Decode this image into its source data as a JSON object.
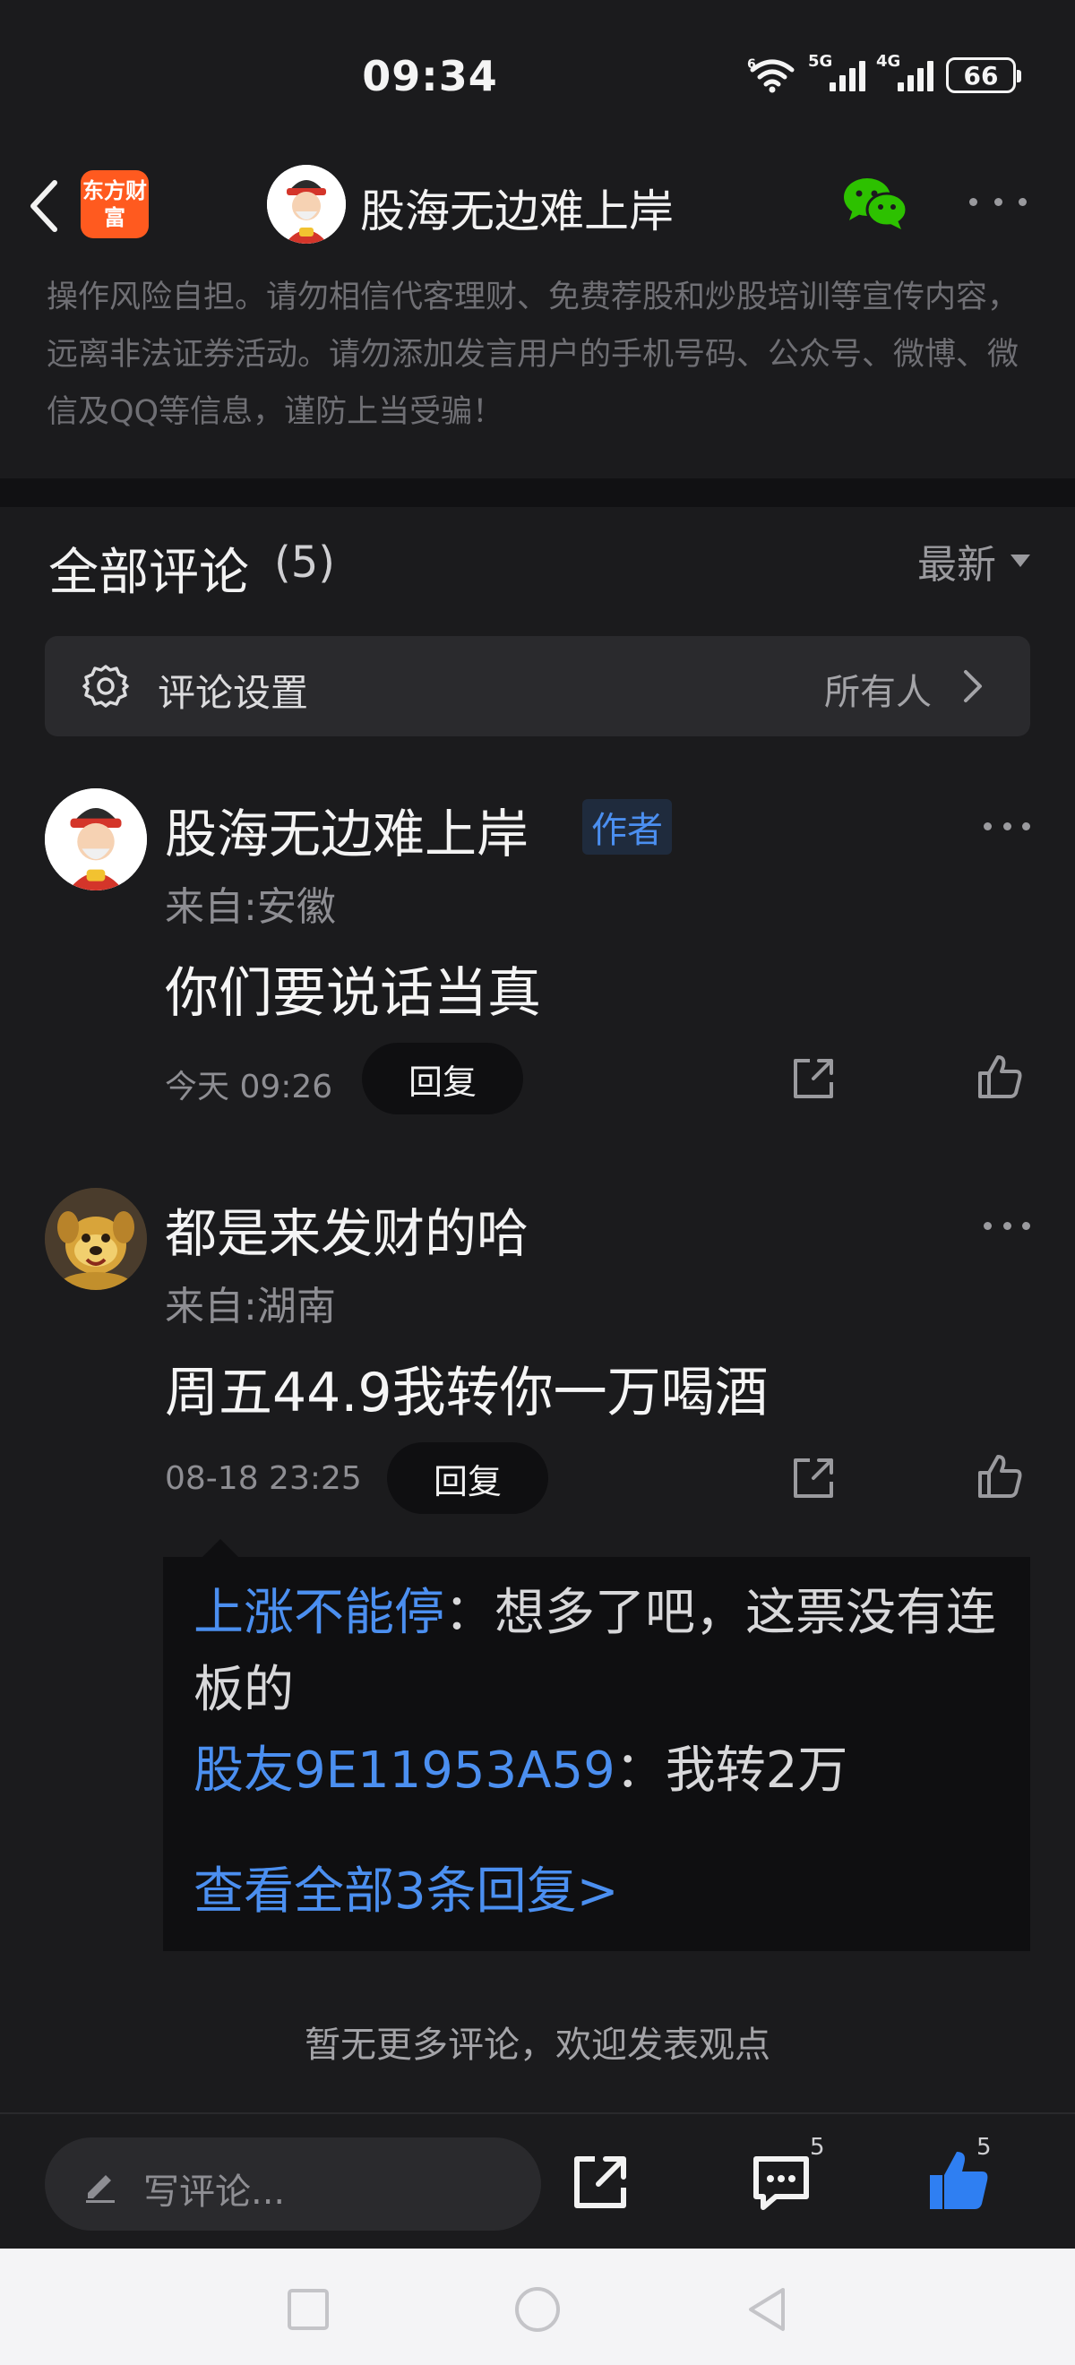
{
  "status_bar": {
    "time": "09:34",
    "network_1": "5G",
    "network_2": "4G",
    "wifi_label": "6",
    "battery": "66"
  },
  "header": {
    "app_logo_text": "东方财富",
    "title": "股海无边难上岸"
  },
  "notice": {
    "text": "操作风险自担。请勿相信代客理财、免费荐股和炒股培训等宣传内容，远离非法证券活动。请勿添加发言用户的手机号码、公众号、微博、微信及QQ等信息，谨防上当受骗！"
  },
  "comments_section": {
    "title": "全部评论",
    "count": "(5)",
    "sort_label": "最新",
    "settings_label": "评论设置",
    "settings_value": "所有人"
  },
  "comments": [
    {
      "username": "股海无边难上岸",
      "badge": "作者",
      "location": "来自:安徽",
      "text": "你们要说话当真",
      "time": "今天 09:26",
      "reply_label": "回复"
    },
    {
      "username": "都是来发财的哈",
      "location": "来自:湖南",
      "text": "周五44.9我转你一万喝酒",
      "time": "08-18 23:25",
      "reply_label": "回复",
      "replies": [
        {
          "user": "上涨不能停",
          "text": "：想多了吧，这票没有连板的"
        },
        {
          "user": "股友9E11953A59",
          "text": "：我转2万"
        }
      ],
      "view_all": "查看全部3条回复>"
    }
  ],
  "end_note": "暂无更多评论，欢迎发表观点",
  "bottom_bar": {
    "compose_placeholder": "写评论...",
    "comment_count": "5",
    "like_count": "5"
  },
  "colors": {
    "background": "#1b1b1d",
    "accent_blue": "#4b8ff0",
    "brand_orange": "#ff5a1f",
    "wechat_green": "#2dc100"
  }
}
